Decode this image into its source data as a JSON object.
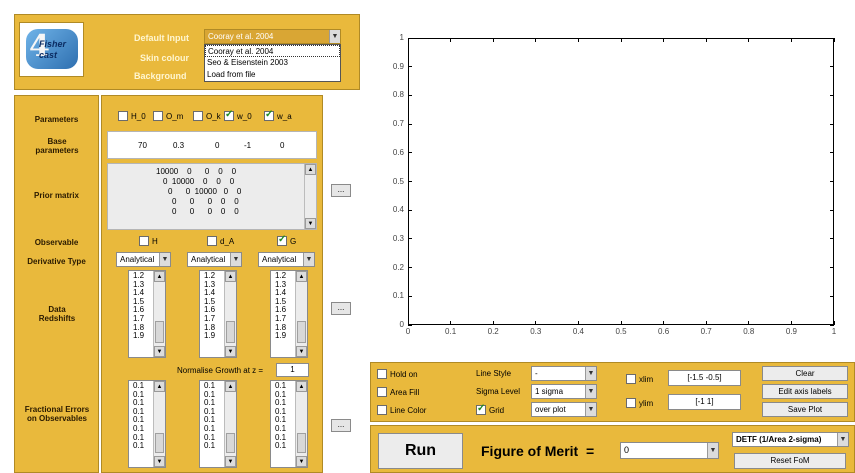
{
  "logo": {
    "text": "Fisher cast",
    "digit": "4"
  },
  "header": {
    "default_input_label": "Default Input",
    "skin_colour_label": "Skin colour",
    "background_label": "Background",
    "default_input_value": "Cooray et al. 2004",
    "dropdown_options": [
      "Cooray et al. 2004",
      "Seo & Eisenstein 2003",
      "Load from file"
    ]
  },
  "params": {
    "label": "Parameters",
    "checkboxes": [
      {
        "label": "H_0",
        "checked": false
      },
      {
        "label": "O_m",
        "checked": false
      },
      {
        "label": "O_k",
        "checked": false
      },
      {
        "label": "w_0",
        "checked": true
      },
      {
        "label": "w_a",
        "checked": true
      }
    ],
    "base_label": "Base parameters",
    "base_values": [
      "70",
      "0.3",
      "0",
      "-1",
      "0"
    ],
    "prior_label": "Prior matrix",
    "prior_rows": [
      "10000    0      0    0    0",
      "0  10000    0    0    0",
      "0      0  10000   0    0",
      "0      0      0    0    0",
      "0      0      0    0    0"
    ]
  },
  "observable": {
    "label": "Observable",
    "checkboxes": [
      {
        "label": "H",
        "checked": false
      },
      {
        "label": "d_A",
        "checked": false
      },
      {
        "label": "G",
        "checked": true
      }
    ],
    "derivative_label": "Derivative Type",
    "derivative_values": [
      "Analytical",
      "Analytical",
      "Analytical"
    ],
    "data_label": "Data Redshifts",
    "redshifts": [
      "1.2",
      "1.3",
      "1.4",
      "1.5",
      "1.6",
      "1.7",
      "1.8",
      "1.9"
    ],
    "normalise_label": "Normalise Growth at z =",
    "normalise_value": "1",
    "errors_label": "Fractional Errors on Observables",
    "errors": [
      "0.1",
      "0.1",
      "0.1",
      "0.1",
      "0.1",
      "0.1",
      "0.1",
      "0.1"
    ],
    "dots": "..."
  },
  "plot": {
    "y_ticks": [
      "0",
      "0.1",
      "0.2",
      "0.3",
      "0.4",
      "0.5",
      "0.6",
      "0.7",
      "0.8",
      "0.9",
      "1"
    ],
    "x_ticks": [
      "0",
      "0.1",
      "0.2",
      "0.3",
      "0.4",
      "0.5",
      "0.6",
      "0.7",
      "0.8",
      "0.9",
      "1"
    ]
  },
  "controls": {
    "hold_on": "Hold on",
    "area_fill": "Area Fill",
    "line_color": "Line Color",
    "line_style_label": "Line Style",
    "line_style_value": "-",
    "sigma_label": "Sigma Level",
    "sigma_value": "1 sigma",
    "grid_label": "Grid",
    "grid_value": "over plot",
    "xlim_label": "xlim",
    "xlim_value": "[-1.5 -0.5]",
    "ylim_label": "ylim",
    "ylim_value": "[-1 1]",
    "clear": "Clear",
    "edit_axis": "Edit axis labels",
    "save_plot": "Save Plot"
  },
  "run_bar": {
    "run": "Run",
    "fom_label": "Figure of Merit  =",
    "fom_value": "0",
    "fom_type": "DETF (1/Area 2-sigma)",
    "reset": "Reset FoM"
  }
}
